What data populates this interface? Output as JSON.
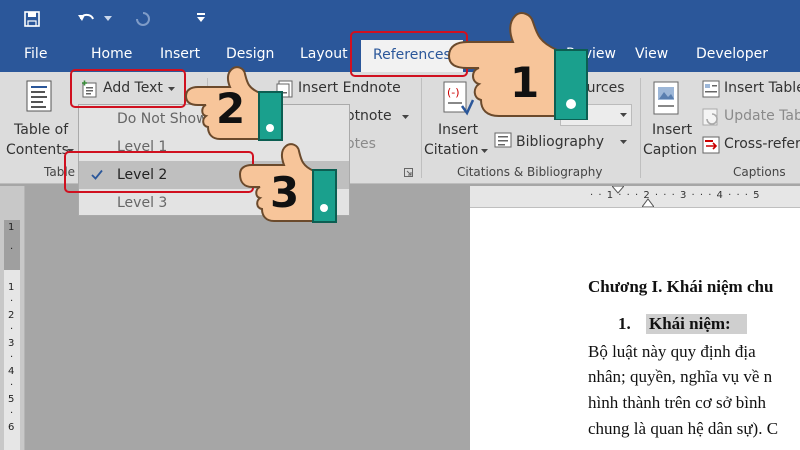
{
  "ribbon_tabs": [
    "File",
    "Home",
    "Insert",
    "Design",
    "Layout",
    "References",
    "Review",
    "View",
    "Developer"
  ],
  "active_tab": "References",
  "toc_group": {
    "button_line1": "Table of",
    "button_line2": "Contents",
    "add_text": "Add Text",
    "group_label": "Table"
  },
  "footnotes_group": {
    "insert_endnote": "Insert Endnote",
    "next_footnote_partial": "otnote",
    "show_notes_partial": "otes",
    "update_toc_partial": "f Contents"
  },
  "citations_group": {
    "insert_line1": "Insert",
    "insert_line2": "Citation",
    "bibliography": "Bibliography",
    "sources_partial": "ources",
    "label": "Citations & Bibliography"
  },
  "captions_group": {
    "insert_line1": "Insert",
    "insert_line2": "Caption",
    "insert_table": "Insert Table",
    "update_table": "Update Table",
    "cross_reference": "Cross-refere",
    "label": "Captions"
  },
  "menu": {
    "items": [
      {
        "label": "Do Not Show",
        "checked": false
      },
      {
        "label": "Level 1",
        "checked": false
      },
      {
        "label": "Level 2",
        "checked": true
      },
      {
        "label": "Level 3",
        "checked": false
      }
    ]
  },
  "ruler": {
    "corner": "L",
    "top": "· · 1 · · · 2 · · · 3 · · · 4 · · · 5",
    "left": [
      "1",
      "·",
      "1",
      "·",
      "2",
      "·",
      "3",
      "·",
      "4",
      "·",
      "5",
      "·",
      "6"
    ]
  },
  "document": {
    "heading": "Chương I. Khái niệm chu",
    "item_number": "1.",
    "item_title": "Khái niệm:",
    "lines": [
      "Bộ luật này quy định địa",
      "nhân; quyền, nghĩa vụ về n",
      "hình thành trên cơ sở bình",
      "chung là quan hệ dân sự). C"
    ]
  },
  "step_badges": [
    "1",
    "2",
    "3"
  ],
  "colors": {
    "title_bar": "#2b579a",
    "highlight_box": "#d0101f",
    "hand_skin": "#f7c59a",
    "cuff": "#1aa08d"
  }
}
